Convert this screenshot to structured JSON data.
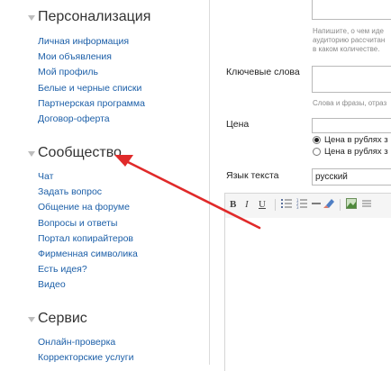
{
  "sidebar": {
    "sections": [
      {
        "title": "Персонализация",
        "items": [
          "Личная информация",
          "Мои объявления",
          "Мой профиль",
          "Белые и черные списки",
          "Партнерская программа",
          "Договор-оферта"
        ]
      },
      {
        "title": "Сообщество",
        "items": [
          "Чат",
          "Задать вопрос",
          "Общение на форуме",
          "Вопросы и ответы",
          "Портал копирайтеров",
          "Фирменная символика",
          "Есть идея?",
          "Видео"
        ]
      },
      {
        "title": "Сервис",
        "items": [
          "Онлайн-проверка",
          "Корректорские услуги"
        ]
      }
    ]
  },
  "form": {
    "description_hint_line1": "Напишите, о чем иде",
    "description_hint_line2": "аудиторию рассчитан",
    "description_hint_line3": "в каком количестве.",
    "keywords_label": "Ключевые слова",
    "keywords_hint": "Слова и фразы, отраз",
    "price_label": "Цена",
    "price_option1": "Цена в рублях з",
    "price_option2": "Цена в рублях з",
    "language_label": "Язык текста",
    "language_value": "русский"
  },
  "toolbar": {
    "bold": "B",
    "italic": "I",
    "underline": "U",
    "bullet_list_icon": "bulleted-list-icon",
    "numbered_list_icon": "numbered-list-icon",
    "hr_icon": "horizontal-rule-icon",
    "eraser_icon": "eraser-icon",
    "image_icon": "image-icon"
  },
  "colors": {
    "link": "#1c5fa8",
    "arrow": "#e02a2a"
  }
}
